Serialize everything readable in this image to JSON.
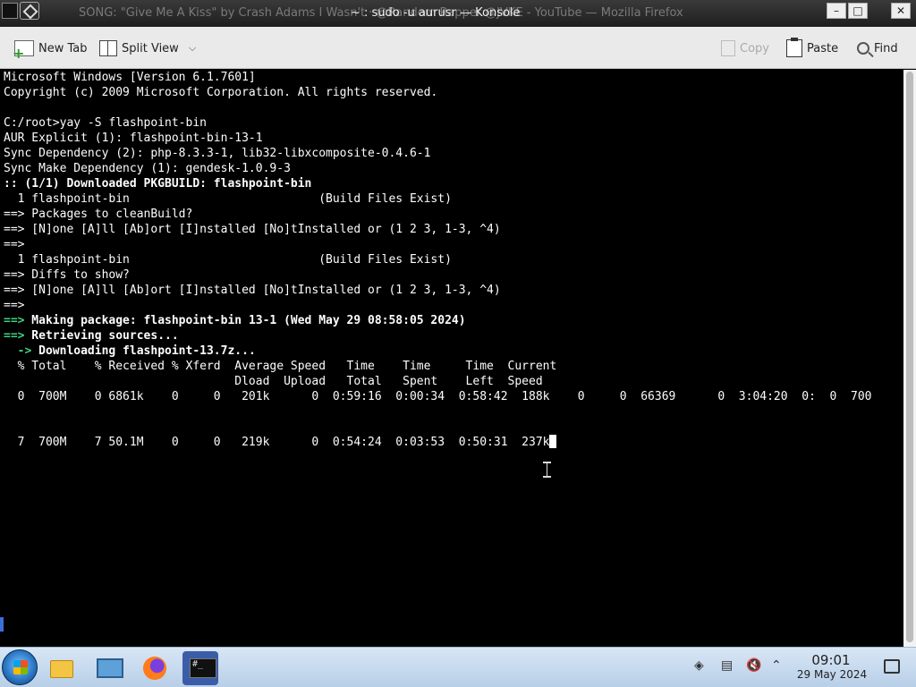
{
  "window": {
    "title_background": "SONG: \"Give Me A Kiss\" by Crash Adams​ I Wasn't · @Random Rapper​ @JVKE - YouTube — Mozilla Firefox",
    "title_foreground": "~ : sudo -u aurusr — Konsole",
    "minimize": "–",
    "maximize": "□",
    "close": "✕"
  },
  "toolbar": {
    "new_tab": "New Tab",
    "split_view": "Split View",
    "copy": "Copy",
    "paste": "Paste",
    "find": "Find"
  },
  "terminal": {
    "lines": [
      "Microsoft Windows [Version 6.1.7601]",
      "Copyright (c) 2009 Microsoft Corporation. All rights reserved.",
      "",
      "C:/root>yay -S flashpoint-bin",
      "AUR Explicit (1): flashpoint-bin-13-1",
      "Sync Dependency (2): php-8.3.3-1, lib32-libxcomposite-0.4.6-1",
      "Sync Make Dependency (1): gendesk-1.0.9-3",
      ":: (1/1) Downloaded PKGBUILD: flashpoint-bin",
      "  1 flashpoint-bin                           (Build Files Exist)",
      "==> Packages to cleanBuild?",
      "==> [N]one [A]ll [Ab]ort [I]nstalled [No]tInstalled or (1 2 3, 1-3, ^4)",
      "==>",
      "  1 flashpoint-bin                           (Build Files Exist)",
      "==> Diffs to show?",
      "==> [N]one [A]ll [Ab]ort [I]nstalled [No]tInstalled or (1 2 3, 1-3, ^4)",
      "==>",
      "==> Making package: flashpoint-bin 13-1 (Wed May 29 08:58:05 2024)",
      "==> Retrieving sources...",
      "  -> Downloading flashpoint-13.7z...",
      "  % Total    % Received % Xferd  Average Speed   Time    Time     Time  Current",
      "                                 Dload  Upload   Total   Spent    Left  Speed",
      "  0  700M    0 6861k    0     0   201k      0  0:59:16  0:00:34  0:58:42  188k    0     0  66369      0  3:04:20  0:  0  700",
      "",
      "",
      "  7  700M    7 50.1M    0     0   219k      0  0:54:24  0:03:53  0:50:31  237k"
    ]
  },
  "taskbar": {
    "clock_time": "09:01",
    "clock_date": "29 May 2024"
  },
  "colors": {
    "terminal_bg": "#000000",
    "terminal_fg": "#fdfdfd",
    "prompt_green": "#3fd27d",
    "toolbar_bg": "#eaeaea"
  }
}
